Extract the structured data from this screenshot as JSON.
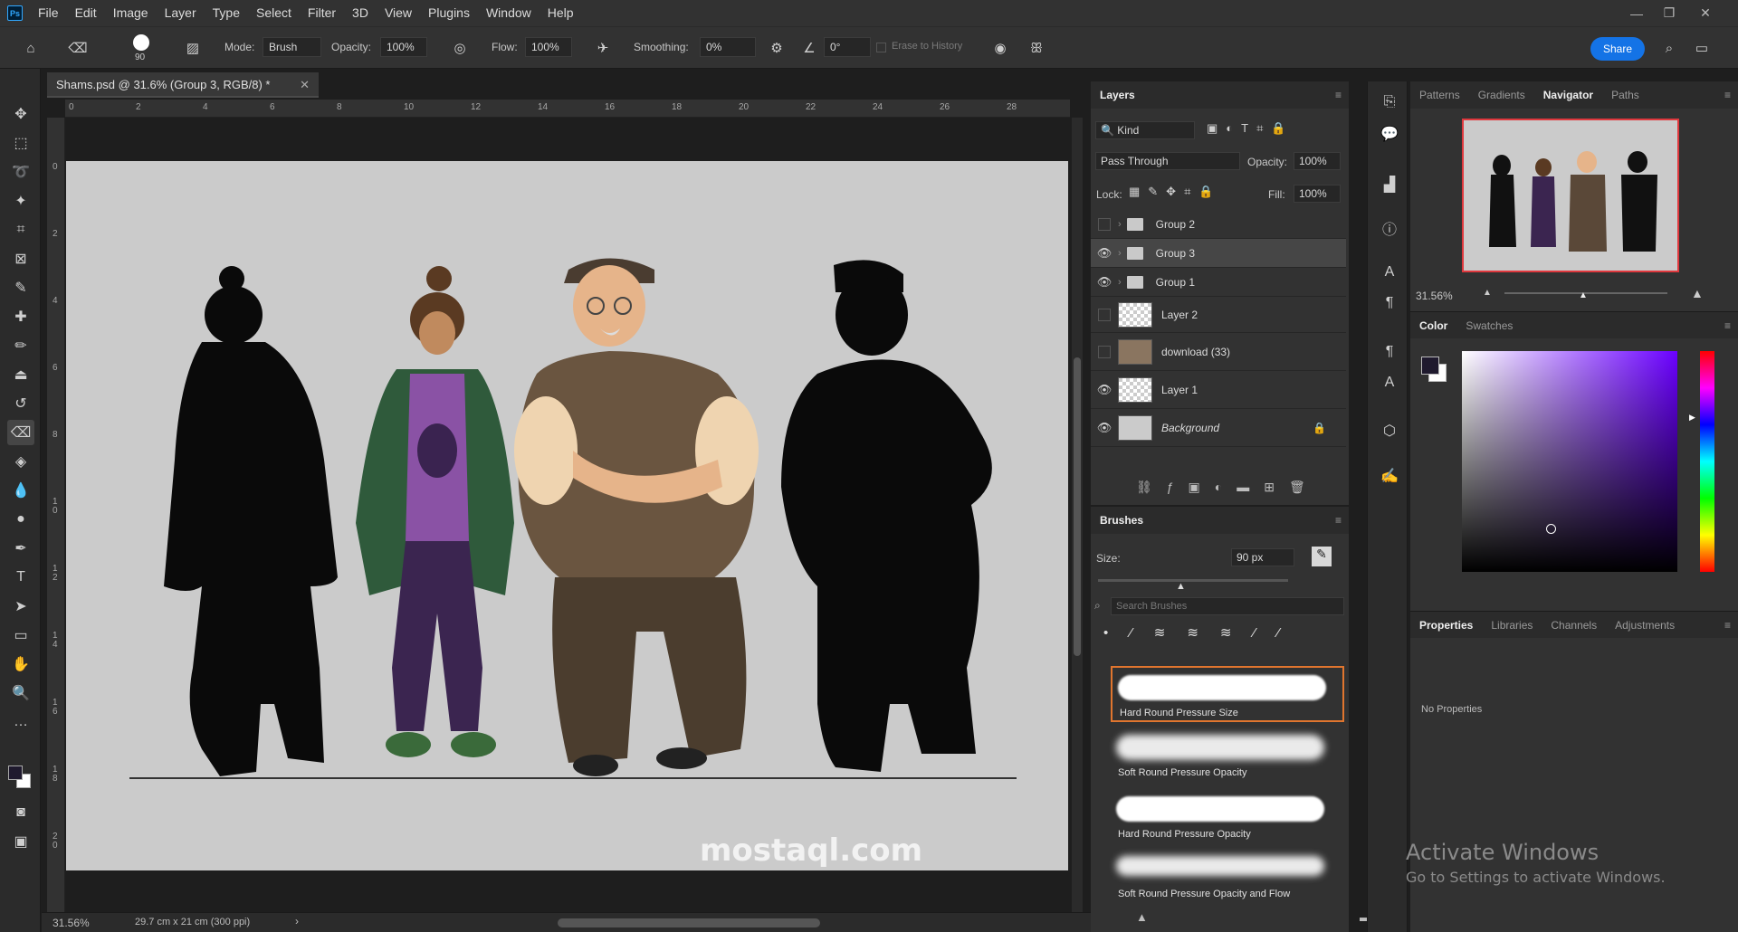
{
  "menubar": {
    "logo": "Ps",
    "items": [
      "File",
      "Edit",
      "Image",
      "Layer",
      "Type",
      "Select",
      "Filter",
      "3D",
      "View",
      "Plugins",
      "Window",
      "Help"
    ]
  },
  "options": {
    "brush_size": "90",
    "mode_label": "Mode:",
    "mode_value": "Brush",
    "opacity_label": "Opacity:",
    "opacity_value": "100%",
    "flow_label": "Flow:",
    "flow_value": "100%",
    "smoothing_label": "Smoothing:",
    "smoothing_value": "0%",
    "angle_value": "0°",
    "erase_history_label": "Erase to History",
    "share_label": "Share"
  },
  "document": {
    "tab_title": "Shams.psd @ 31.6% (Group 3, RGB/8) *",
    "h_ruler_ticks": [
      "0",
      "2",
      "4",
      "6",
      "8",
      "10",
      "12",
      "14",
      "16",
      "18",
      "20",
      "22",
      "24",
      "26",
      "28"
    ],
    "v_ruler_ticks": [
      "0",
      "2",
      "4",
      "6",
      "8",
      "1\n0",
      "1\n2",
      "1\n4",
      "1\n6",
      "1\n8",
      "2\n0"
    ],
    "watermark": "mostaql.com"
  },
  "status": {
    "zoom": "31.56%",
    "doc_info": "29.7 cm x 21 cm (300 ppi)"
  },
  "layers_panel": {
    "tab": "Layers",
    "filter_kind": "Kind",
    "blend_mode": "Pass Through",
    "opacity_label": "Opacity:",
    "opacity_value": "100%",
    "lock_label": "Lock:",
    "fill_label": "Fill:",
    "fill_value": "100%",
    "layers": [
      {
        "name": "Group 2",
        "type": "group",
        "visible": false
      },
      {
        "name": "Group 3",
        "type": "group",
        "visible": true
      },
      {
        "name": "Group 1",
        "type": "group",
        "visible": true
      },
      {
        "name": "Layer 2",
        "type": "layer",
        "visible": false
      },
      {
        "name": "download (33)",
        "type": "layer",
        "visible": false
      },
      {
        "name": "Layer 1",
        "type": "layer",
        "visible": true
      },
      {
        "name": "Background",
        "type": "background",
        "visible": true
      }
    ]
  },
  "brushes_panel": {
    "tab": "Brushes",
    "size_label": "Size:",
    "size_value": "90 px",
    "search_placeholder": "Search Brushes",
    "brushes": [
      "Hard Round Pressure Size",
      "Soft Round Pressure Opacity",
      "Hard Round Pressure Opacity",
      "Soft Round Pressure Opacity and Flow"
    ]
  },
  "navigator_panel": {
    "tabs": [
      "Patterns",
      "Gradients",
      "Navigator",
      "Paths"
    ],
    "active_tab": "Navigator",
    "zoom": "31.56%"
  },
  "color_panel": {
    "tabs": [
      "Color",
      "Swatches"
    ],
    "active_tab": "Color",
    "foreground": "#1f1a2e",
    "background": "#ffffff",
    "hue_color": "#6a00ff"
  },
  "properties_panel": {
    "tabs": [
      "Properties",
      "Libraries",
      "Channels",
      "Adjustments"
    ],
    "active_tab": "Properties",
    "empty_text": "No Properties"
  },
  "activation": {
    "title": "Activate Windows",
    "subtitle": "Go to Settings to activate Windows."
  }
}
